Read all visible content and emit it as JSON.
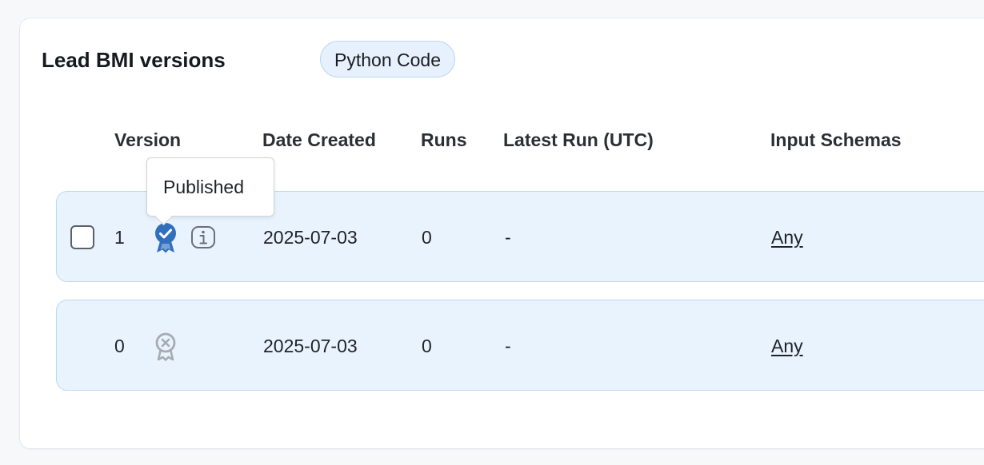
{
  "header": {
    "title": "Lead BMI versions",
    "type_chip": "Python Code"
  },
  "table": {
    "columns": [
      "Version",
      "Date Created",
      "Runs",
      "Latest Run (UTC)",
      "Input Schemas"
    ],
    "rows": [
      {
        "version": "1",
        "status_icon": "published-badge-icon",
        "date_created": "2025-07-03",
        "runs": "0",
        "latest_run": "-",
        "input_schemas": "Any"
      },
      {
        "version": "0",
        "status_icon": "unpublished-badge-icon",
        "date_created": "2025-07-03",
        "runs": "0",
        "latest_run": "-",
        "input_schemas": "Any"
      }
    ]
  },
  "tooltip": {
    "text": "Published"
  },
  "colors": {
    "row_background": "#e8f3fd",
    "row_border": "#bcd9f3",
    "published_icon": "#2f6fbd",
    "unpublished_icon": "#a6abb2",
    "chip_background": "#e7f1fd"
  }
}
